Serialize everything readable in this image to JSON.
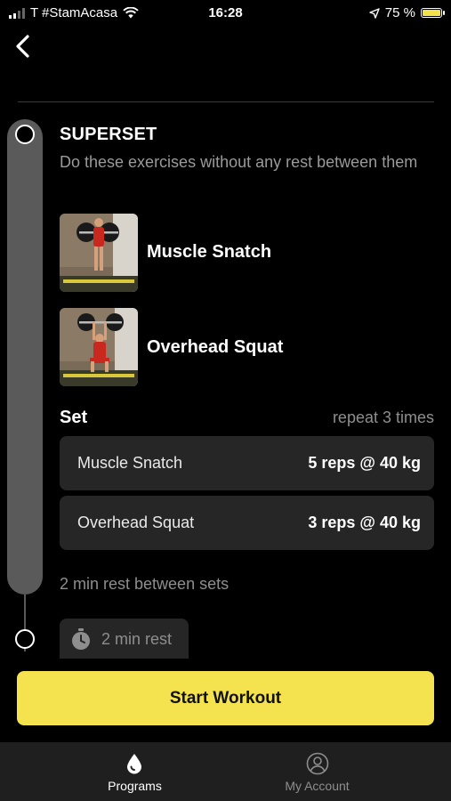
{
  "status_bar": {
    "carrier": "T #StamAcasa",
    "time": "16:28",
    "battery": "75 %"
  },
  "superset": {
    "title": "SUPERSET",
    "description": "Do these exercises without any rest between them"
  },
  "exercises": [
    {
      "name": "Muscle Snatch",
      "image": "muscle-snatch-photo"
    },
    {
      "name": "Overhead Squat",
      "image": "overhead-squat-photo"
    }
  ],
  "set": {
    "label": "Set",
    "repeat": "repeat 3 times",
    "rows": [
      {
        "name": "Muscle Snatch",
        "reps": "5 reps @ 40 kg"
      },
      {
        "name": "Overhead Squat",
        "reps": "3 reps @ 40 kg"
      }
    ],
    "rest_between": "2 min rest between sets"
  },
  "rest_chip": {
    "label": "2 min rest",
    "icon": "stopwatch-icon"
  },
  "start_button": {
    "label": "Start Workout"
  },
  "tabbar": {
    "items": [
      {
        "label": "Programs",
        "icon": "drop-icon",
        "active": true
      },
      {
        "label": "My Account",
        "icon": "user-icon",
        "active": false
      }
    ]
  },
  "colors": {
    "accent": "#f4e34f",
    "background": "#000000",
    "card": "#262626",
    "muted_text": "#8e8e8e",
    "timeline": "#5a5a5a"
  }
}
